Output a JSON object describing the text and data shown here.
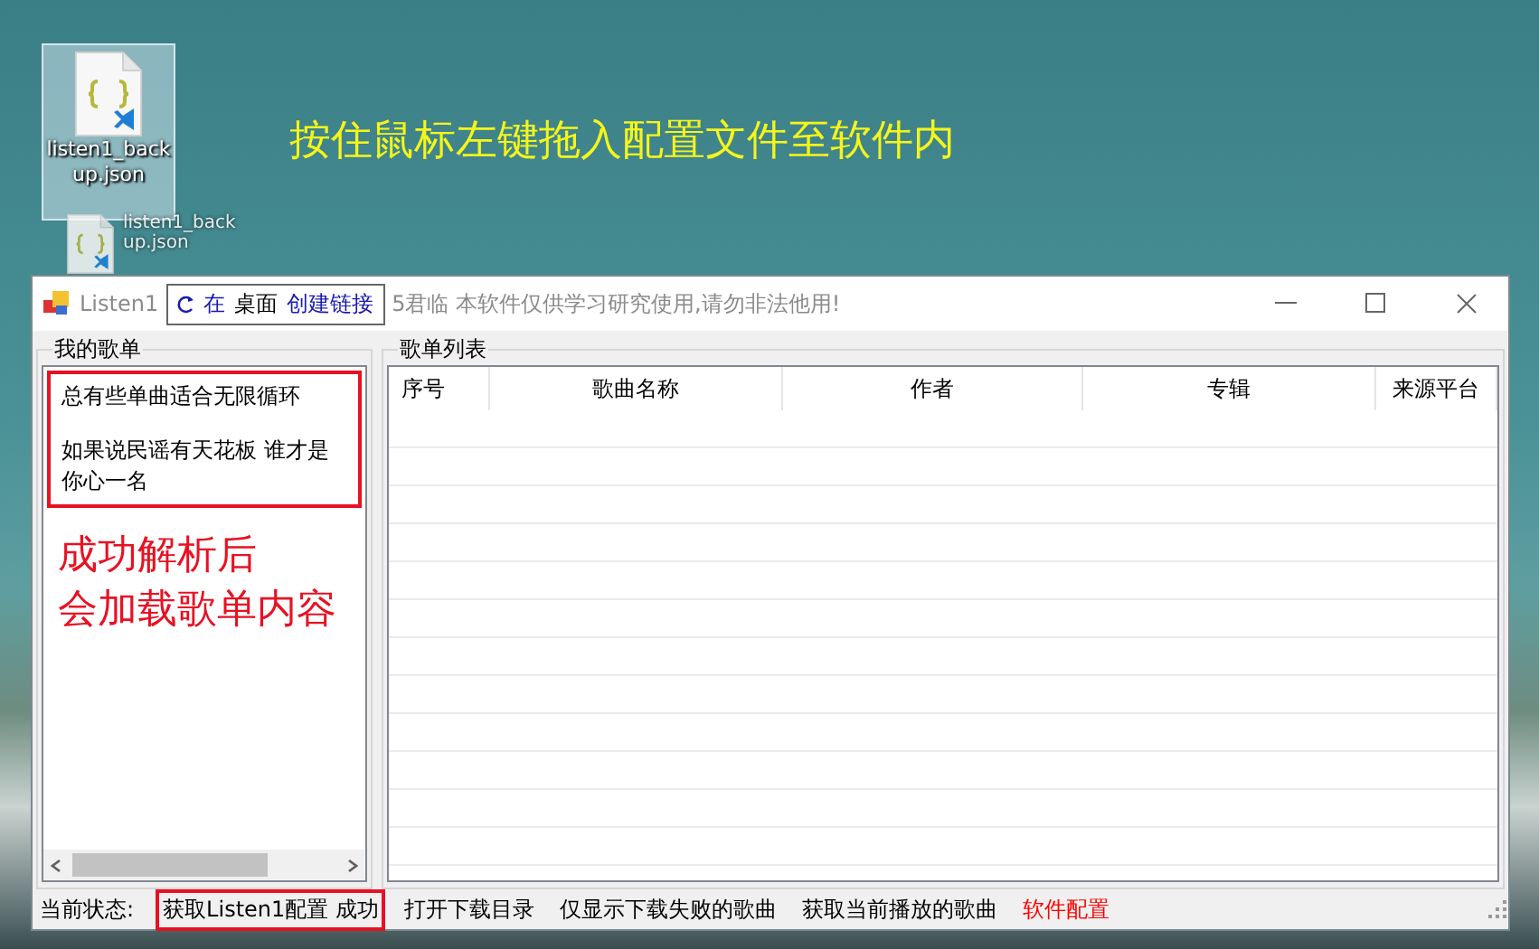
{
  "desktop": {
    "file_icon": {
      "label": "listen1_backup.json",
      "selected": true
    },
    "drag_ghost": {
      "label": "listen1_backup.json"
    },
    "annotation": "按住鼠标左键拖入配置文件至软件内",
    "drop_tooltip": {
      "action": "在",
      "target": "桌面",
      "link": "创建链接"
    }
  },
  "window": {
    "title_start": "Listen1",
    "title_end": "5君临 本软件仅供学习研究使用,请勿非法他用!"
  },
  "my_playlists": {
    "title": "我的歌单",
    "annotated": true,
    "items": [
      {
        "label": "总有些单曲适合无限循环"
      },
      {
        "label": "如果说民谣有天花板 谁才是你心一名"
      }
    ],
    "note_lines": [
      "成功解析后",
      "会加载歌单内容"
    ]
  },
  "playlist_table": {
    "title": "歌单列表",
    "columns": [
      "序号",
      "歌曲名称",
      "作者",
      "专辑",
      "来源平台"
    ]
  },
  "status_bar": {
    "label": "当前状态:",
    "items": [
      {
        "text": "获取Listen1配置 成功",
        "annotated": true,
        "highlight": false
      },
      {
        "text": "打开下载目录",
        "annotated": false,
        "highlight": false
      },
      {
        "text": "仅显示下载失败的歌曲",
        "annotated": false,
        "highlight": false
      },
      {
        "text": "获取当前播放的歌曲",
        "annotated": false,
        "highlight": false
      },
      {
        "text": "软件配置",
        "annotated": false,
        "highlight": true
      }
    ]
  }
}
